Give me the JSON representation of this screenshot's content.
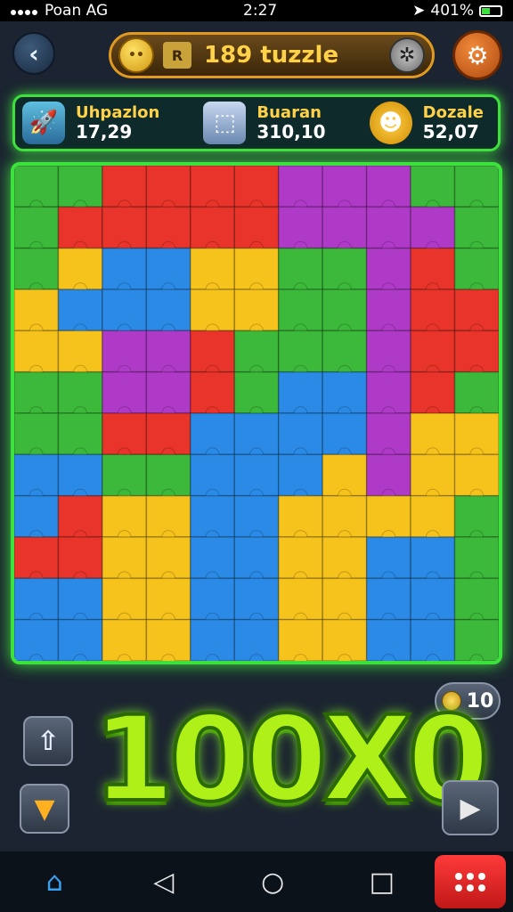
{
  "status": {
    "carrier": "Poan AG",
    "time": "2:27",
    "battery": "401%"
  },
  "header": {
    "back_icon": "chevron-left-icon",
    "title": "189 tuzzle",
    "title_coin": "••",
    "title_icon_text": "R"
  },
  "stats": [
    {
      "label": "Uhpazlon",
      "value": "17,29",
      "icon": "rocket-icon"
    },
    {
      "label": "Buaran",
      "value": "310,10",
      "icon": "cube-icon"
    },
    {
      "label": "Dozale",
      "value": "52,07",
      "icon": "badge-icon"
    }
  ],
  "board": {
    "rows": 12,
    "cols": 11,
    "colors": {
      "red": "#e8342a",
      "orange": "#f07818",
      "yellow": "#f6c21c",
      "green": "#3cb83a",
      "blue": "#2a8ae6",
      "purple": "#b03ac8",
      "lime": "#8ad828"
    },
    "grid": [
      "GGRRRRPPPGG",
      "GRRRRRPPPPG",
      "GYBBYYGGPRG",
      "YBBBYYGGPRR",
      "YYPPRGGGPRR",
      "GGPPRGBBPRG",
      "GGRRBBBBPYY",
      "BBGGBBBYPYY",
      "BRYYBBYYYYG",
      "RRYYBBYYBBG",
      "BBYYBBYYBBG",
      "BBYYBBYYBBG"
    ]
  },
  "coins": {
    "count": "10"
  },
  "score": {
    "text": "100X0"
  },
  "controls": {
    "up_icon": "arrow-up-icon",
    "down_icon": "funnel-icon",
    "play_icon": "play-icon"
  },
  "nav": {
    "home": "home-icon",
    "back": "triangle-back-icon",
    "circle": "circle-home-icon",
    "square": "square-recents-icon",
    "menu": "grid-menu-icon"
  }
}
